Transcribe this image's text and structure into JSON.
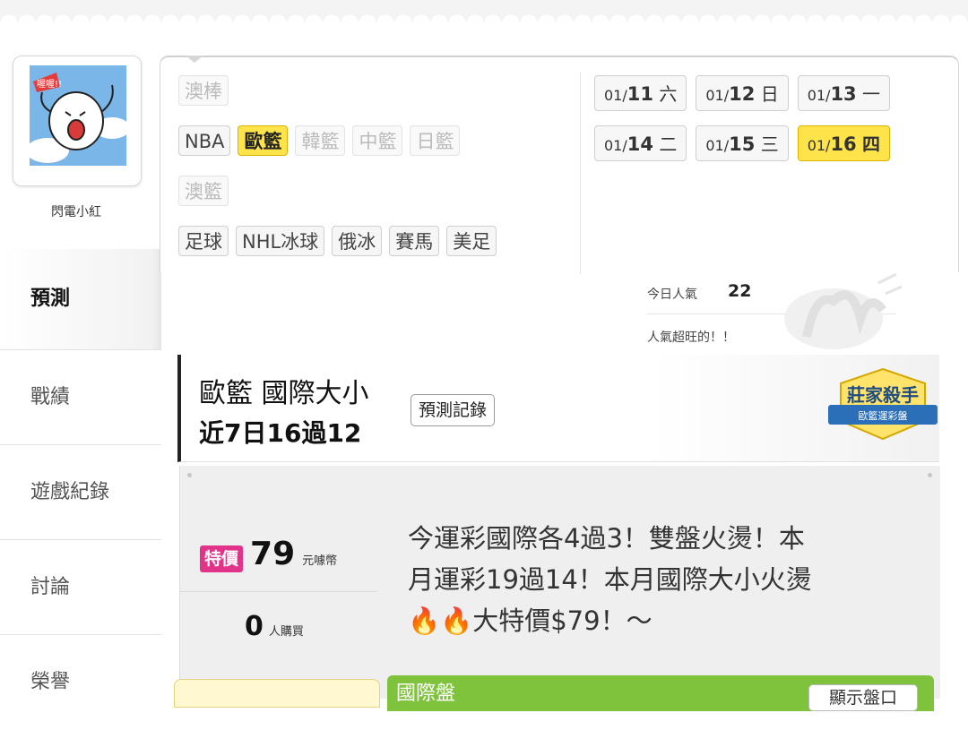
{
  "user": {
    "name": "閃電小紅"
  },
  "nav": [
    {
      "label": "預測",
      "active": true
    },
    {
      "label": "戰績"
    },
    {
      "label": "遊戲紀錄"
    },
    {
      "label": "討論"
    },
    {
      "label": "榮譽"
    }
  ],
  "categories": {
    "row1": [
      "澳棒"
    ],
    "row2": [
      "NBA",
      "歐籃",
      "韓籃",
      "中籃",
      "日籃"
    ],
    "row3": [
      "澳籃"
    ],
    "row4": [
      "足球",
      "NHL冰球",
      "俄冰",
      "賽馬",
      "美足"
    ],
    "active": "歐籃"
  },
  "dates": [
    {
      "month": "01/",
      "day": "11",
      "weekday": "六"
    },
    {
      "month": "01/",
      "day": "12",
      "weekday": "日"
    },
    {
      "month": "01/",
      "day": "13",
      "weekday": "一"
    },
    {
      "month": "01/",
      "day": "14",
      "weekday": "二"
    },
    {
      "month": "01/",
      "day": "15",
      "weekday": "三"
    },
    {
      "month": "01/",
      "day": "16",
      "weekday": "四",
      "active": true
    }
  ],
  "popularity": {
    "label": "今日人氣",
    "count": "22",
    "message": "人氣超旺的！！"
  },
  "prediction": {
    "title": "歐籃 國際大小",
    "record": "近7日16過12",
    "history_button": "預測記錄",
    "badge_title": "莊家殺手",
    "badge_sub": "歐籃運彩盤"
  },
  "pricing": {
    "special_label": "特價",
    "price": "79",
    "currency": "元噱幣",
    "buyers": "0",
    "buyers_unit": "人購買"
  },
  "promo": {
    "line1": "今運彩國際各4過3！雙盤火燙！本",
    "line2": "月運彩19過14！本月國際大小火燙",
    "line3_emoji": "🔥🔥",
    "line3": "大特價$79！～"
  },
  "bottom": {
    "section_label": "國際盤",
    "show_button": "顯示盤口"
  },
  "colors": {
    "active_yellow": "#ffe34a",
    "special_pink": "#e2338a",
    "bar_green": "#7fc33c"
  }
}
